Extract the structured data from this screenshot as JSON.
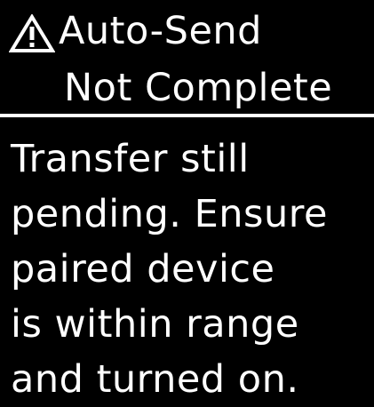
{
  "screen": {
    "icon": "warning-triangle-icon",
    "title_line_1": "Auto-Send",
    "title_line_2": "Not Complete",
    "message_lines": [
      "Transfer still",
      "pending. Ensure",
      "paired device",
      "is within range",
      "and turned on."
    ]
  },
  "colors": {
    "background": "#000000",
    "foreground": "#ffffff"
  }
}
